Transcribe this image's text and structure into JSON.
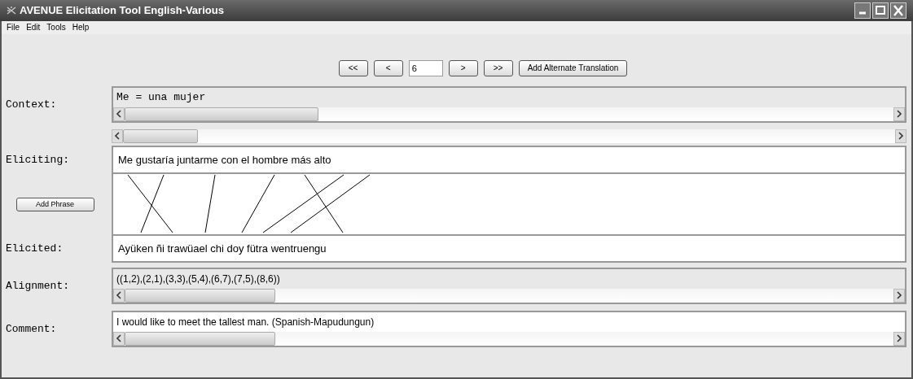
{
  "window": {
    "title": "AVENUE Elicitation Tool English-Various"
  },
  "menu": [
    {
      "label": "File"
    },
    {
      "label": "Edit"
    },
    {
      "label": "Tools"
    },
    {
      "label": "Help"
    }
  ],
  "navigation": [
    {
      "kind": "button",
      "label": "<<"
    },
    {
      "kind": "button",
      "label": "<"
    },
    {
      "kind": "field",
      "value": "6"
    },
    {
      "kind": "button",
      "label": ">"
    },
    {
      "kind": "button",
      "label": ">>"
    },
    {
      "kind": "wide_button",
      "label": "Add Alternate Translation"
    }
  ],
  "context": {
    "label": "Context:",
    "value": "Me = una mujer"
  },
  "eliciting": {
    "label": "Eliciting:",
    "value": "Me gustaría juntarme con el hombre más alto"
  },
  "add_phrase_button": {
    "label": "Add Phrase"
  },
  "elicited": {
    "label": "Elicited:",
    "value": "Ayüken ñi trawüael chi doy fütra wentruengu"
  },
  "alignment": {
    "label": "Alignment:",
    "value": "((1,2),(2,1),(3,3),(5,4),(6,7),(7,5),(8,6))"
  },
  "comment": {
    "label": "Comment:",
    "value": "I would like to meet the tallest man. (Spanish-Mapudungun)"
  }
}
